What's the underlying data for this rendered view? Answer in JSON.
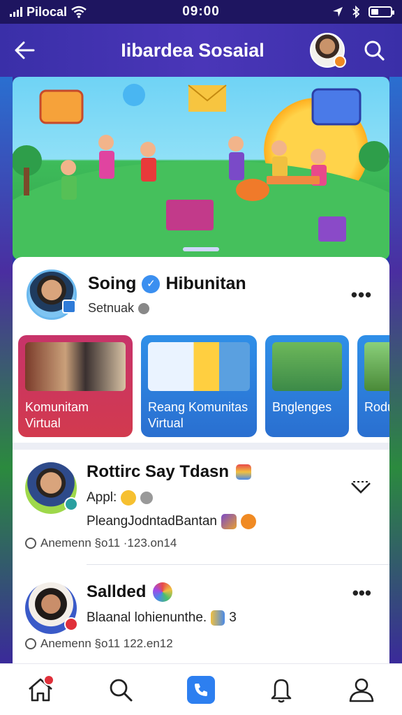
{
  "status_bar": {
    "carrier": "Pilocal",
    "time": "09:00"
  },
  "header": {
    "title": "Iibardea Sosaial"
  },
  "profile": {
    "name_first": "Soing",
    "name_last": "Hibunitan",
    "subtitle": "Setnuak"
  },
  "tiles": [
    {
      "line1": "Komunitam",
      "line2": "Virtual"
    },
    {
      "line1": "Reang Komunitas",
      "line2": "Virtual"
    },
    {
      "line1": "Bnglenges",
      "line2": ""
    },
    {
      "line1": "Rodun",
      "line2": ""
    }
  ],
  "posts": [
    {
      "title": "Rottirc Say Tdasn",
      "line1": "Appl:",
      "line2": "PleangJodntadBantan",
      "meta": "Anemenn §o11 ·123.on14"
    },
    {
      "title": "Sallded",
      "line1": "Blaanal lohienunthe.",
      "line1_suffix": "3",
      "meta": "Anemenn §o11 122.en12"
    }
  ],
  "colors": {
    "header": "#3a2fa8",
    "accent": "#2d7ff0",
    "tile_red": "#c7336a",
    "tile_blue": "#2f8fe8"
  },
  "icons": {
    "back": "arrow-left-icon",
    "search": "search-icon",
    "more": "more-horizontal-icon",
    "chevron": "chevron-down-icon",
    "nav": [
      "home-icon",
      "search-icon",
      "phone-icon",
      "bell-icon",
      "user-icon"
    ]
  }
}
